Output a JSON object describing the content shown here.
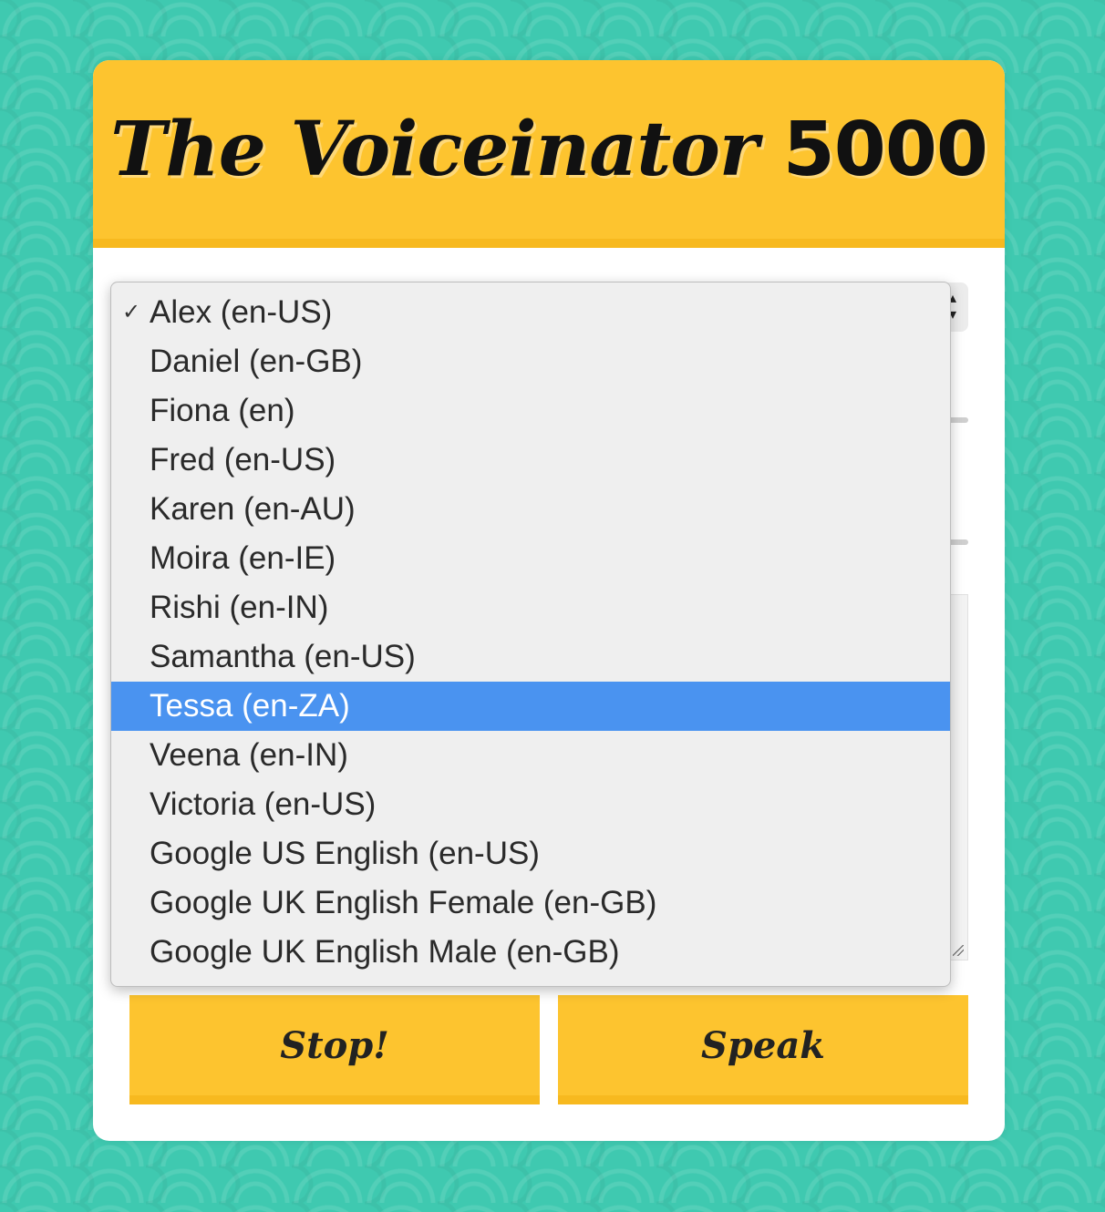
{
  "app": {
    "title_script": "The Voiceinator",
    "title_number": "5000"
  },
  "voice_select": {
    "selected_index": 0,
    "highlighted_index": 8,
    "checkmark": "✓",
    "options": [
      "Alex (en-US)",
      "Daniel (en-GB)",
      "Fiona (en)",
      "Fred (en-US)",
      "Karen (en-AU)",
      "Moira (en-IE)",
      "Rishi (en-IN)",
      "Samantha (en-US)",
      "Tessa (en-ZA)",
      "Veena (en-IN)",
      "Victoria (en-US)",
      "Google US English (en-US)",
      "Google UK English Female (en-GB)",
      "Google UK English Male (en-GB)"
    ]
  },
  "buttons": {
    "stop_label": "Stop!",
    "speak_label": "Speak"
  },
  "colors": {
    "background": "#3fc9b0",
    "accent_yellow": "#fdc42f",
    "highlight_blue": "#4a93f0"
  },
  "icons": {
    "select_arrows": "updown-chevron-icon",
    "checkmark": "checkmark-icon",
    "resize_grip": "resize-grip-icon"
  }
}
